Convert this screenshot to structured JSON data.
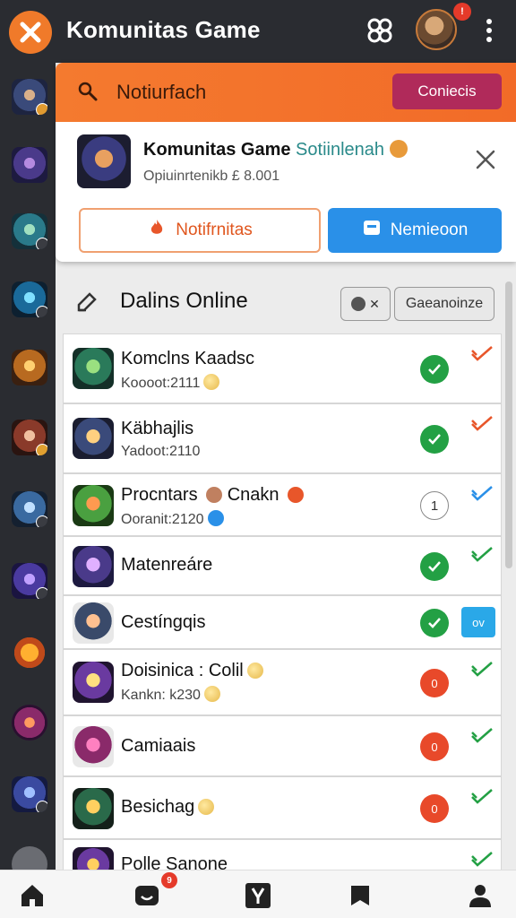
{
  "app": {
    "title": "Komunitas Game",
    "avatar_badge": "!"
  },
  "colors": {
    "accent_orange": "#f47a2f",
    "dark_bg": "#2a2c31",
    "connect_button": "#b02a5a",
    "primary_blue": "#2a90e8",
    "status_green": "#23a044",
    "status_red": "#e8492a"
  },
  "icons": {
    "close": "close-icon",
    "clover": "clover-icon",
    "more": "more-vertical-icon",
    "search": "search-icon",
    "edit": "edit-icon",
    "check": "check-icon"
  },
  "notification": {
    "title": "Notiurfach",
    "connect_label": "Coniecis",
    "card_title": "Komunitas Game",
    "card_title_accent": "Sotiinlenah",
    "card_subtitle": "Opiuinrtenikb £ 8.001",
    "outline_button": "Notifrnitas",
    "primary_button": "Nemieoon"
  },
  "online": {
    "title": "Dalins Online",
    "small_button": "✕",
    "filter_button": "Gaeanoinze",
    "rows": [
      {
        "name": "Komclns Kaadsc",
        "sub": "Koooot:2111",
        "coin": true,
        "status": "green",
        "status_text": "",
        "right": "tick-orange"
      },
      {
        "name": "Käbhajlis",
        "sub": "Yadoot:2110",
        "coin": false,
        "status": "green",
        "status_text": "",
        "right": "tick-orange"
      },
      {
        "name": "Procntars",
        "name_extra": "Cnakn",
        "sub": "Ooranit:2120",
        "coin": false,
        "status": "outline",
        "status_text": "1",
        "right": "tick-blue"
      },
      {
        "name": "Matenreáre",
        "sub": "",
        "coin": false,
        "status": "green",
        "status_text": "",
        "right": "tick-green"
      },
      {
        "name": "Cestíngqis",
        "sub": "",
        "coin": false,
        "status": "green",
        "status_text": "",
        "right": "chip",
        "chip_label": "ov"
      },
      {
        "name": "Doisinica : Colil",
        "sub": "Kankn: k230",
        "coin": true,
        "status": "red",
        "status_text": "0",
        "right": "tick-green"
      },
      {
        "name": "Camiaais",
        "sub": "",
        "coin": false,
        "status": "red",
        "status_text": "0",
        "right": "tick-green"
      },
      {
        "name": "Besichag",
        "sub": "",
        "coin": true,
        "status": "red",
        "status_text": "0",
        "right": "tick-green"
      },
      {
        "name": "Polle Sanone",
        "sub": "",
        "coin": false,
        "status": "",
        "status_text": "",
        "right": "tick-green"
      }
    ]
  },
  "bottom_nav": {
    "items": [
      "home-icon",
      "chat-icon",
      "game-icon",
      "bookmark-icon",
      "profile-icon"
    ],
    "chat_badge": "9"
  }
}
